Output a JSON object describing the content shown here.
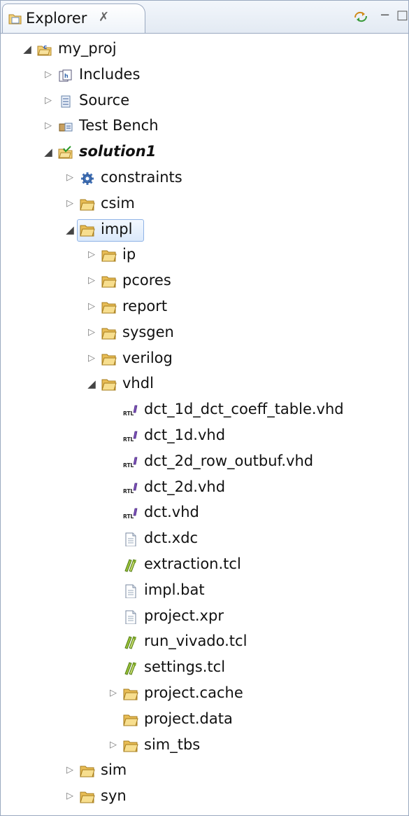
{
  "tab": {
    "label": "Explorer",
    "close": "✗"
  },
  "header_buttons": {
    "link": "link-editor-icon",
    "minimize": "−",
    "maximize": "□"
  },
  "tree": [
    {
      "label": "my_proj",
      "depth": 0,
      "twisty": "expanded",
      "icon": "project-icon",
      "bold": false
    },
    {
      "label": "Includes",
      "depth": 1,
      "twisty": "collapsed",
      "icon": "includes-icon",
      "bold": false
    },
    {
      "label": "Source",
      "depth": 1,
      "twisty": "collapsed",
      "icon": "source-icon",
      "bold": false
    },
    {
      "label": "Test Bench",
      "depth": 1,
      "twisty": "collapsed",
      "icon": "testbench-icon",
      "bold": false
    },
    {
      "label": "solution1",
      "depth": 1,
      "twisty": "expanded",
      "icon": "solution-icon",
      "bold": true
    },
    {
      "label": "constraints",
      "depth": 2,
      "twisty": "collapsed",
      "icon": "gear-icon",
      "bold": false
    },
    {
      "label": "csim",
      "depth": 2,
      "twisty": "collapsed",
      "icon": "folder-icon",
      "bold": false
    },
    {
      "label": "impl",
      "depth": 2,
      "twisty": "expanded",
      "icon": "folder-icon",
      "bold": false,
      "selected": true
    },
    {
      "label": "ip",
      "depth": 3,
      "twisty": "collapsed",
      "icon": "folder-icon",
      "bold": false
    },
    {
      "label": "pcores",
      "depth": 3,
      "twisty": "collapsed",
      "icon": "folder-icon",
      "bold": false
    },
    {
      "label": "report",
      "depth": 3,
      "twisty": "collapsed",
      "icon": "folder-icon",
      "bold": false
    },
    {
      "label": "sysgen",
      "depth": 3,
      "twisty": "collapsed",
      "icon": "folder-icon",
      "bold": false
    },
    {
      "label": "verilog",
      "depth": 3,
      "twisty": "collapsed",
      "icon": "folder-icon",
      "bold": false
    },
    {
      "label": "vhdl",
      "depth": 3,
      "twisty": "expanded",
      "icon": "folder-icon",
      "bold": false
    },
    {
      "label": "dct_1d_dct_coeff_table.vhd",
      "depth": 4,
      "twisty": "none",
      "icon": "rtl-icon",
      "bold": false
    },
    {
      "label": "dct_1d.vhd",
      "depth": 4,
      "twisty": "none",
      "icon": "rtl-icon",
      "bold": false
    },
    {
      "label": "dct_2d_row_outbuf.vhd",
      "depth": 4,
      "twisty": "none",
      "icon": "rtl-icon",
      "bold": false
    },
    {
      "label": "dct_2d.vhd",
      "depth": 4,
      "twisty": "none",
      "icon": "rtl-icon",
      "bold": false
    },
    {
      "label": "dct.vhd",
      "depth": 4,
      "twisty": "none",
      "icon": "rtl-icon",
      "bold": false
    },
    {
      "label": "dct.xdc",
      "depth": 4,
      "twisty": "none",
      "icon": "file-icon",
      "bold": false
    },
    {
      "label": "extraction.tcl",
      "depth": 4,
      "twisty": "none",
      "icon": "tcl-icon",
      "bold": false
    },
    {
      "label": "impl.bat",
      "depth": 4,
      "twisty": "none",
      "icon": "file-icon",
      "bold": false
    },
    {
      "label": "project.xpr",
      "depth": 4,
      "twisty": "none",
      "icon": "file-icon",
      "bold": false
    },
    {
      "label": "run_vivado.tcl",
      "depth": 4,
      "twisty": "none",
      "icon": "tcl-icon",
      "bold": false
    },
    {
      "label": "settings.tcl",
      "depth": 4,
      "twisty": "none",
      "icon": "tcl-icon",
      "bold": false
    },
    {
      "label": "project.cache",
      "depth": 4,
      "twisty": "collapsed",
      "icon": "folder-icon",
      "bold": false
    },
    {
      "label": "project.data",
      "depth": 4,
      "twisty": "none",
      "icon": "folder-icon",
      "bold": false
    },
    {
      "label": "sim_tbs",
      "depth": 4,
      "twisty": "collapsed",
      "icon": "folder-icon",
      "bold": false
    },
    {
      "label": "sim",
      "depth": 2,
      "twisty": "collapsed",
      "icon": "folder-icon",
      "bold": false
    },
    {
      "label": "syn",
      "depth": 2,
      "twisty": "collapsed",
      "icon": "folder-icon",
      "bold": false
    }
  ]
}
